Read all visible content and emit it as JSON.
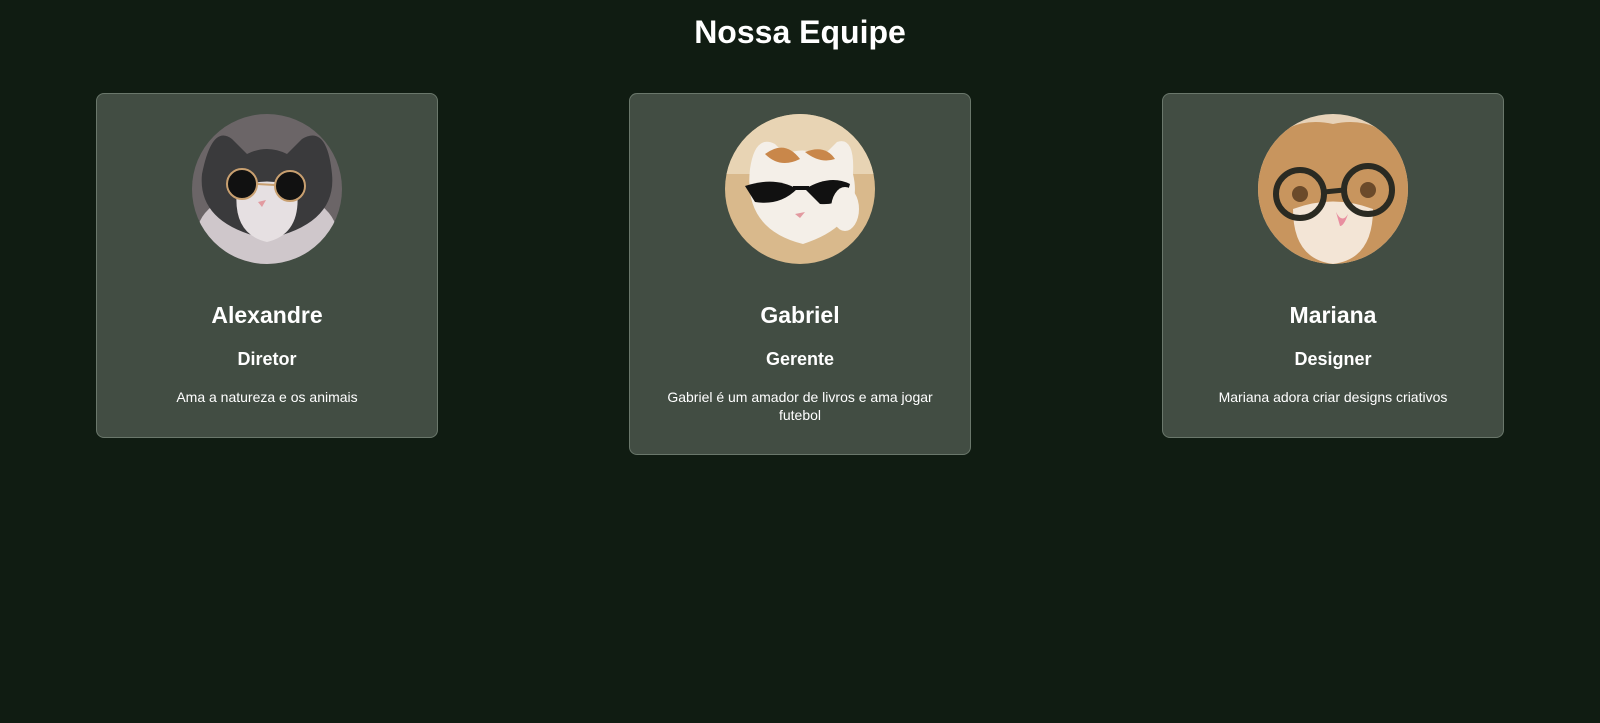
{
  "page": {
    "title": "Nossa Equipe"
  },
  "team": [
    {
      "name": "Alexandre",
      "role": "Diretor",
      "description": "Ama a natureza e os animais",
      "avatar_icon": "cat-round-sunglasses-photo"
    },
    {
      "name": "Gabriel",
      "role": "Gerente",
      "description": "Gabriel é um amador de livros e ama jogar futebol",
      "avatar_icon": "cat-black-sunglasses-photo"
    },
    {
      "name": "Mariana",
      "role": "Designer",
      "description": "Mariana adora criar designs criativos",
      "avatar_icon": "cat-round-glasses-photo"
    }
  ],
  "colors": {
    "background": "#101c12",
    "card": "#424d43",
    "card_border": "#6a776b",
    "text": "#ffffff"
  }
}
